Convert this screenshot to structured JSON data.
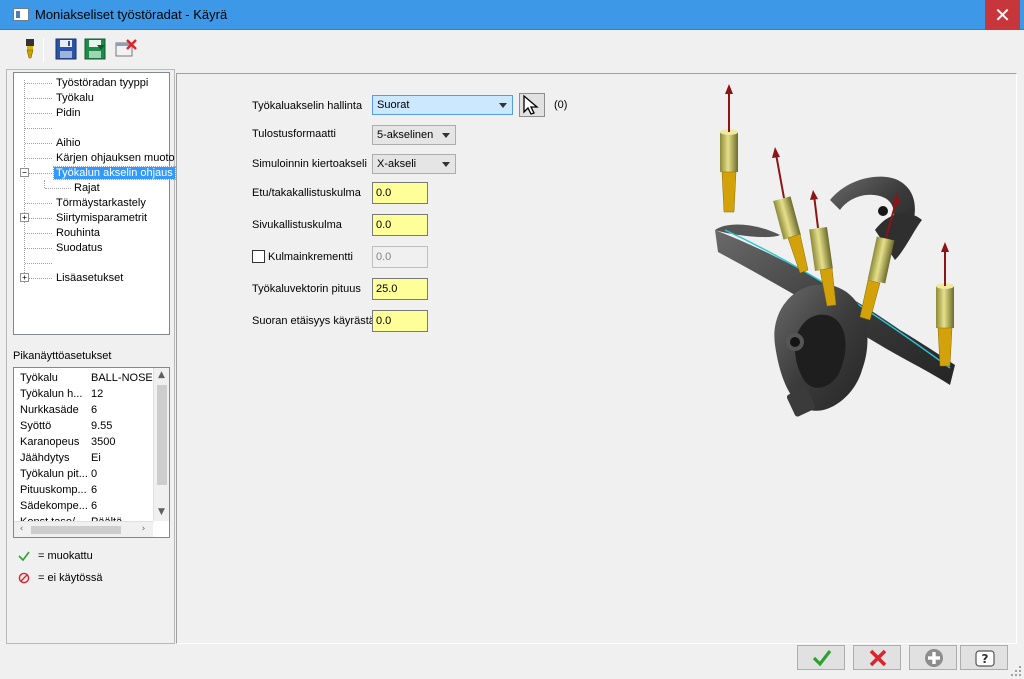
{
  "window": {
    "title": "Moniakseliset työstöradat - Käyrä",
    "close_glyph": "✕"
  },
  "toolbar": {
    "icons": [
      "tool-icon",
      "save-icon",
      "save-as-icon",
      "delete-icon"
    ]
  },
  "tree": {
    "items": [
      {
        "label": "Työstöradan tyyppi"
      },
      {
        "label": "Työkalu"
      },
      {
        "label": "Pidin"
      },
      {
        "label": ""
      },
      {
        "label": "Aihio"
      },
      {
        "label": "Kärjen ohjauksen muoto"
      },
      {
        "label": "Työkalun akselin ohjaus",
        "selected": true,
        "expander": "−"
      },
      {
        "label": "Rajat"
      },
      {
        "label": "Törmäystarkastely"
      },
      {
        "label": "Siirtymisparametrit",
        "expander": "+"
      },
      {
        "label": "Rouhinta"
      },
      {
        "label": "Suodatus"
      },
      {
        "label": ""
      },
      {
        "label": "Lisäasetukset",
        "expander": "+"
      }
    ]
  },
  "quick_view": {
    "title": "Pikanäyttöasetukset",
    "rows": [
      {
        "key": "Työkalu",
        "value": "BALL-NOSE ..."
      },
      {
        "key": "Työkalun h...",
        "value": "12"
      },
      {
        "key": "Nurkkasäde",
        "value": "6"
      },
      {
        "key": "Syöttö",
        "value": "9.55"
      },
      {
        "key": "Karanopeus",
        "value": "3500"
      },
      {
        "key": "Jäähdytys",
        "value": "Ei"
      },
      {
        "key": "Työkalun pit...",
        "value": "0"
      },
      {
        "key": "Pituuskomp...",
        "value": "6"
      },
      {
        "key": "Sädekompe...",
        "value": "6"
      },
      {
        "key": "Konst.taso/...",
        "value": "Päältä"
      }
    ]
  },
  "legend": {
    "modified": "= muokattu",
    "disabled": "= ei käytössä"
  },
  "form": {
    "tool_axis_control": {
      "label": "Työkaluakselin hallinta",
      "value": "Suorat"
    },
    "pick_count": "(0)",
    "output_format": {
      "label": "Tulostusformaatti",
      "value": "5-akselinen"
    },
    "sim_rotary_axis": {
      "label": "Simuloinnin kiertoakseli",
      "value": "X-akseli"
    },
    "lead_lag_angle": {
      "label": "Etu/takakallistuskulma",
      "value": "0.0"
    },
    "side_tilt_angle": {
      "label": "Sivukallistuskulma",
      "value": "0.0"
    },
    "angle_increment": {
      "label": "Kulmainkrementti",
      "value": "0.0",
      "checked": false
    },
    "tool_vector_length": {
      "label": "Työkaluvektorin pituus",
      "value": "25.0"
    },
    "line_distance": {
      "label": "Suoran etäisyys käyrästä",
      "value": "0.0"
    }
  },
  "buttons": {
    "ok": "ok-icon",
    "cancel": "cancel-icon",
    "add": "add-icon",
    "help": "help-icon"
  },
  "colors": {
    "titlebar": "#3d99e8",
    "close": "#c7363a",
    "field_highlight": "#ffff99",
    "selection": "#3399ff",
    "ok_green": "#2ea12e",
    "cancel_red": "#d9262c"
  }
}
